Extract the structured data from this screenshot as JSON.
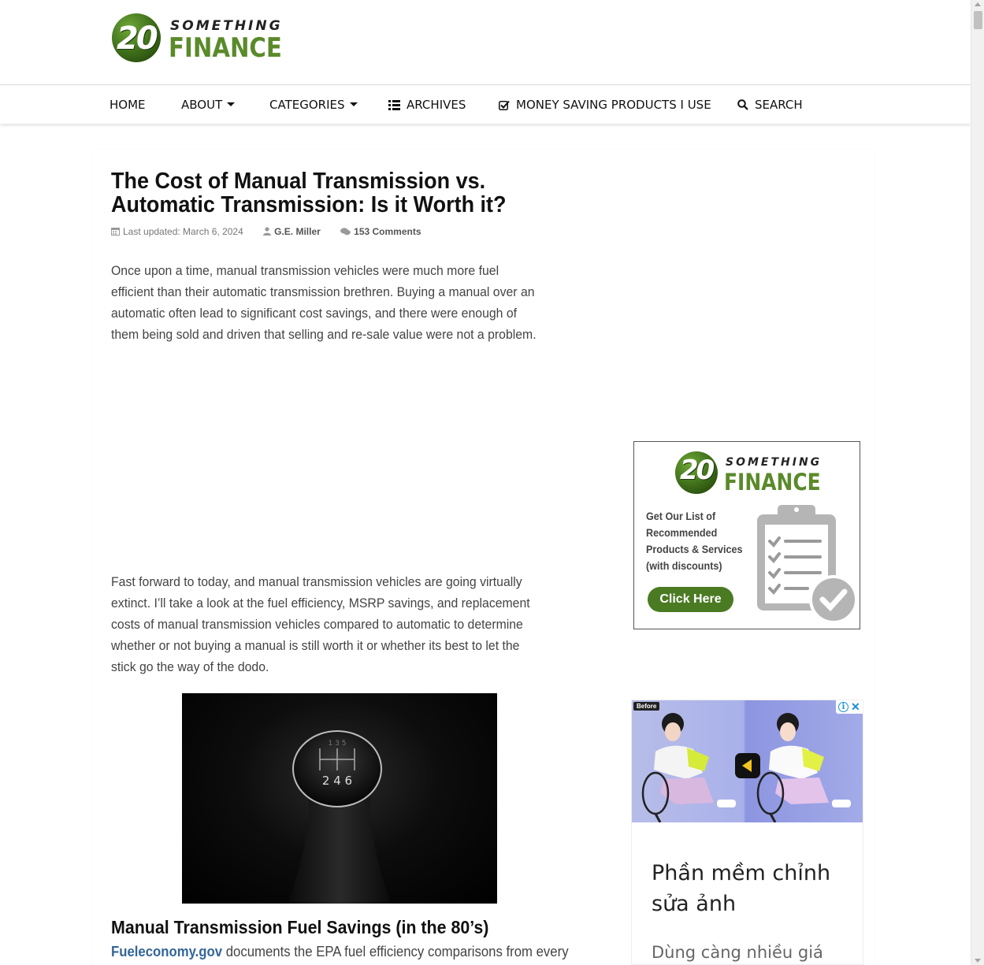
{
  "site": {
    "logo_num": "20",
    "logo_top": "SOMETHING",
    "logo_bottom": "FINANCE"
  },
  "nav": {
    "home": "HOME",
    "about": "ABOUT",
    "categories": "CATEGORIES",
    "archives": "ARCHIVES",
    "products": "MONEY SAVING PRODUCTS I USE",
    "search": "SEARCH"
  },
  "article": {
    "title": "The Cost of Manual Transmission vs. Automatic Transmission: Is it Worth it?",
    "updated": "Last updated: March 6, 2024",
    "author": "G.E. Miller",
    "comments": "153 Comments",
    "para1": "Once upon a time, manual transmission vehicles were much more fuel efficient than their automatic transmission brethren. Buying a manual over an automatic often lead to significant cost savings, and there were enough of them being sold and driven that selling and re-sale value were not a problem.",
    "para2": "Fast forward to today, and manual transmission vehicles are going virtually extinct. I’ll take a look at the fuel efficiency, MSRP savings, and replacement costs of manual transmission vehicles compared to automatic to determine whether or not buying a manual is still worth it or whether its best to let the stick go the way of the dodo.",
    "image_knob_text": "2 4 6",
    "h2": "Manual Transmission Fuel Savings (in the 80’s)",
    "para3_link": "Fueleconomy.gov",
    "para3_rest": " documents the EPA fuel efficiency comparisons from every"
  },
  "promo": {
    "logo_num": "20",
    "logo_top": "SOMETHING",
    "logo_bottom": "FINANCE",
    "text": "Get Our List of Recommended Products & Services (with discounts)",
    "button": "Click Here"
  },
  "ad": {
    "before_badge": "Before",
    "title": "Phần mềm chỉnh sửa ảnh",
    "subtitle": "Dùng càng nhiều giá"
  },
  "colors": {
    "brand_green": "#5a8a2a",
    "link_blue": "#336699",
    "button_green": "#4a7a22"
  }
}
